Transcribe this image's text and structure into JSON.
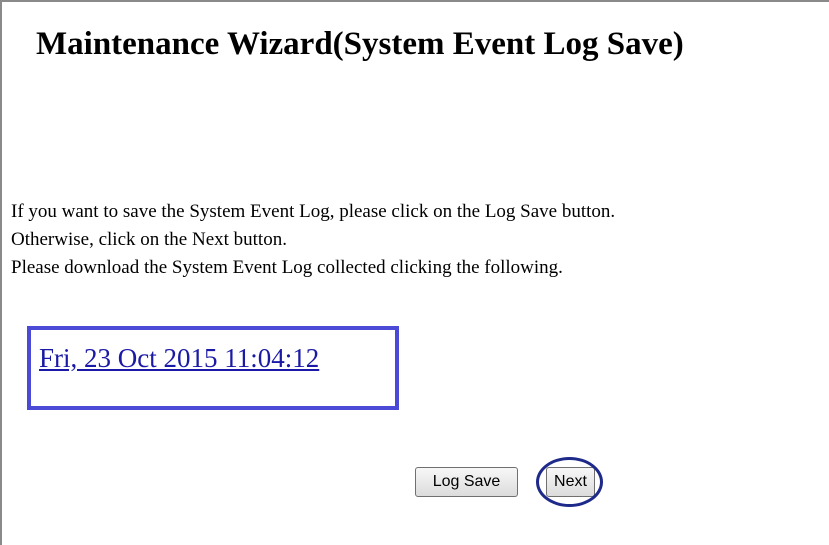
{
  "page": {
    "title": "Maintenance Wizard(System Event Log Save)"
  },
  "message": {
    "lines": [
      "If you want to save the System Event Log, please click on the Log Save button.",
      "Otherwise, click on the Next button.",
      "Please download the System Event Log collected clicking the following."
    ]
  },
  "log_link": {
    "label": "Fri, 23 Oct 2015 11:04:12"
  },
  "buttons": {
    "log_save_label": "Log Save",
    "next_label": "Next"
  },
  "colors": {
    "highlight_box": "#4b4ad6",
    "next_ring": "#1e2a8a",
    "link": "#1a1aa6"
  }
}
